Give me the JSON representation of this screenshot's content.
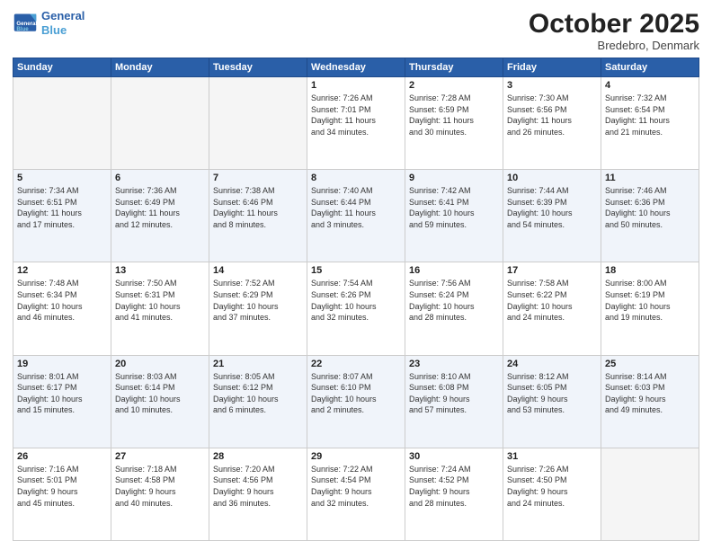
{
  "header": {
    "logo_line1": "General",
    "logo_line2": "Blue",
    "month": "October 2025",
    "location": "Bredebro, Denmark"
  },
  "days_of_week": [
    "Sunday",
    "Monday",
    "Tuesday",
    "Wednesday",
    "Thursday",
    "Friday",
    "Saturday"
  ],
  "weeks": [
    [
      {
        "day": "",
        "info": ""
      },
      {
        "day": "",
        "info": ""
      },
      {
        "day": "",
        "info": ""
      },
      {
        "day": "1",
        "info": "Sunrise: 7:26 AM\nSunset: 7:01 PM\nDaylight: 11 hours\nand 34 minutes."
      },
      {
        "day": "2",
        "info": "Sunrise: 7:28 AM\nSunset: 6:59 PM\nDaylight: 11 hours\nand 30 minutes."
      },
      {
        "day": "3",
        "info": "Sunrise: 7:30 AM\nSunset: 6:56 PM\nDaylight: 11 hours\nand 26 minutes."
      },
      {
        "day": "4",
        "info": "Sunrise: 7:32 AM\nSunset: 6:54 PM\nDaylight: 11 hours\nand 21 minutes."
      }
    ],
    [
      {
        "day": "5",
        "info": "Sunrise: 7:34 AM\nSunset: 6:51 PM\nDaylight: 11 hours\nand 17 minutes."
      },
      {
        "day": "6",
        "info": "Sunrise: 7:36 AM\nSunset: 6:49 PM\nDaylight: 11 hours\nand 12 minutes."
      },
      {
        "day": "7",
        "info": "Sunrise: 7:38 AM\nSunset: 6:46 PM\nDaylight: 11 hours\nand 8 minutes."
      },
      {
        "day": "8",
        "info": "Sunrise: 7:40 AM\nSunset: 6:44 PM\nDaylight: 11 hours\nand 3 minutes."
      },
      {
        "day": "9",
        "info": "Sunrise: 7:42 AM\nSunset: 6:41 PM\nDaylight: 10 hours\nand 59 minutes."
      },
      {
        "day": "10",
        "info": "Sunrise: 7:44 AM\nSunset: 6:39 PM\nDaylight: 10 hours\nand 54 minutes."
      },
      {
        "day": "11",
        "info": "Sunrise: 7:46 AM\nSunset: 6:36 PM\nDaylight: 10 hours\nand 50 minutes."
      }
    ],
    [
      {
        "day": "12",
        "info": "Sunrise: 7:48 AM\nSunset: 6:34 PM\nDaylight: 10 hours\nand 46 minutes."
      },
      {
        "day": "13",
        "info": "Sunrise: 7:50 AM\nSunset: 6:31 PM\nDaylight: 10 hours\nand 41 minutes."
      },
      {
        "day": "14",
        "info": "Sunrise: 7:52 AM\nSunset: 6:29 PM\nDaylight: 10 hours\nand 37 minutes."
      },
      {
        "day": "15",
        "info": "Sunrise: 7:54 AM\nSunset: 6:26 PM\nDaylight: 10 hours\nand 32 minutes."
      },
      {
        "day": "16",
        "info": "Sunrise: 7:56 AM\nSunset: 6:24 PM\nDaylight: 10 hours\nand 28 minutes."
      },
      {
        "day": "17",
        "info": "Sunrise: 7:58 AM\nSunset: 6:22 PM\nDaylight: 10 hours\nand 24 minutes."
      },
      {
        "day": "18",
        "info": "Sunrise: 8:00 AM\nSunset: 6:19 PM\nDaylight: 10 hours\nand 19 minutes."
      }
    ],
    [
      {
        "day": "19",
        "info": "Sunrise: 8:01 AM\nSunset: 6:17 PM\nDaylight: 10 hours\nand 15 minutes."
      },
      {
        "day": "20",
        "info": "Sunrise: 8:03 AM\nSunset: 6:14 PM\nDaylight: 10 hours\nand 10 minutes."
      },
      {
        "day": "21",
        "info": "Sunrise: 8:05 AM\nSunset: 6:12 PM\nDaylight: 10 hours\nand 6 minutes."
      },
      {
        "day": "22",
        "info": "Sunrise: 8:07 AM\nSunset: 6:10 PM\nDaylight: 10 hours\nand 2 minutes."
      },
      {
        "day": "23",
        "info": "Sunrise: 8:10 AM\nSunset: 6:08 PM\nDaylight: 9 hours\nand 57 minutes."
      },
      {
        "day": "24",
        "info": "Sunrise: 8:12 AM\nSunset: 6:05 PM\nDaylight: 9 hours\nand 53 minutes."
      },
      {
        "day": "25",
        "info": "Sunrise: 8:14 AM\nSunset: 6:03 PM\nDaylight: 9 hours\nand 49 minutes."
      }
    ],
    [
      {
        "day": "26",
        "info": "Sunrise: 7:16 AM\nSunset: 5:01 PM\nDaylight: 9 hours\nand 45 minutes."
      },
      {
        "day": "27",
        "info": "Sunrise: 7:18 AM\nSunset: 4:58 PM\nDaylight: 9 hours\nand 40 minutes."
      },
      {
        "day": "28",
        "info": "Sunrise: 7:20 AM\nSunset: 4:56 PM\nDaylight: 9 hours\nand 36 minutes."
      },
      {
        "day": "29",
        "info": "Sunrise: 7:22 AM\nSunset: 4:54 PM\nDaylight: 9 hours\nand 32 minutes."
      },
      {
        "day": "30",
        "info": "Sunrise: 7:24 AM\nSunset: 4:52 PM\nDaylight: 9 hours\nand 28 minutes."
      },
      {
        "day": "31",
        "info": "Sunrise: 7:26 AM\nSunset: 4:50 PM\nDaylight: 9 hours\nand 24 minutes."
      },
      {
        "day": "",
        "info": ""
      }
    ]
  ]
}
